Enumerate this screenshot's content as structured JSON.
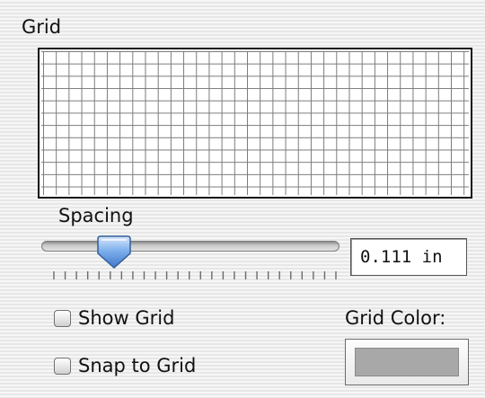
{
  "grid_panel": {
    "title": "Grid",
    "spacing": {
      "label": "Spacing",
      "value": "0.111 in",
      "slider_position": 0.22,
      "tick_count": 26
    },
    "show_grid": {
      "label": "Show Grid",
      "checked": false
    },
    "snap_to_grid": {
      "label": "Snap to Grid",
      "checked": false
    },
    "grid_color": {
      "label": "Grid Color:",
      "value": "#a8a8a8"
    },
    "colors": {
      "grid_lines": "#7a7a7a",
      "slider_thumb": "#5b8fd6"
    },
    "icons": {
      "slider_thumb": "slider-thumb-icon",
      "checkbox": "checkbox-icon"
    }
  }
}
